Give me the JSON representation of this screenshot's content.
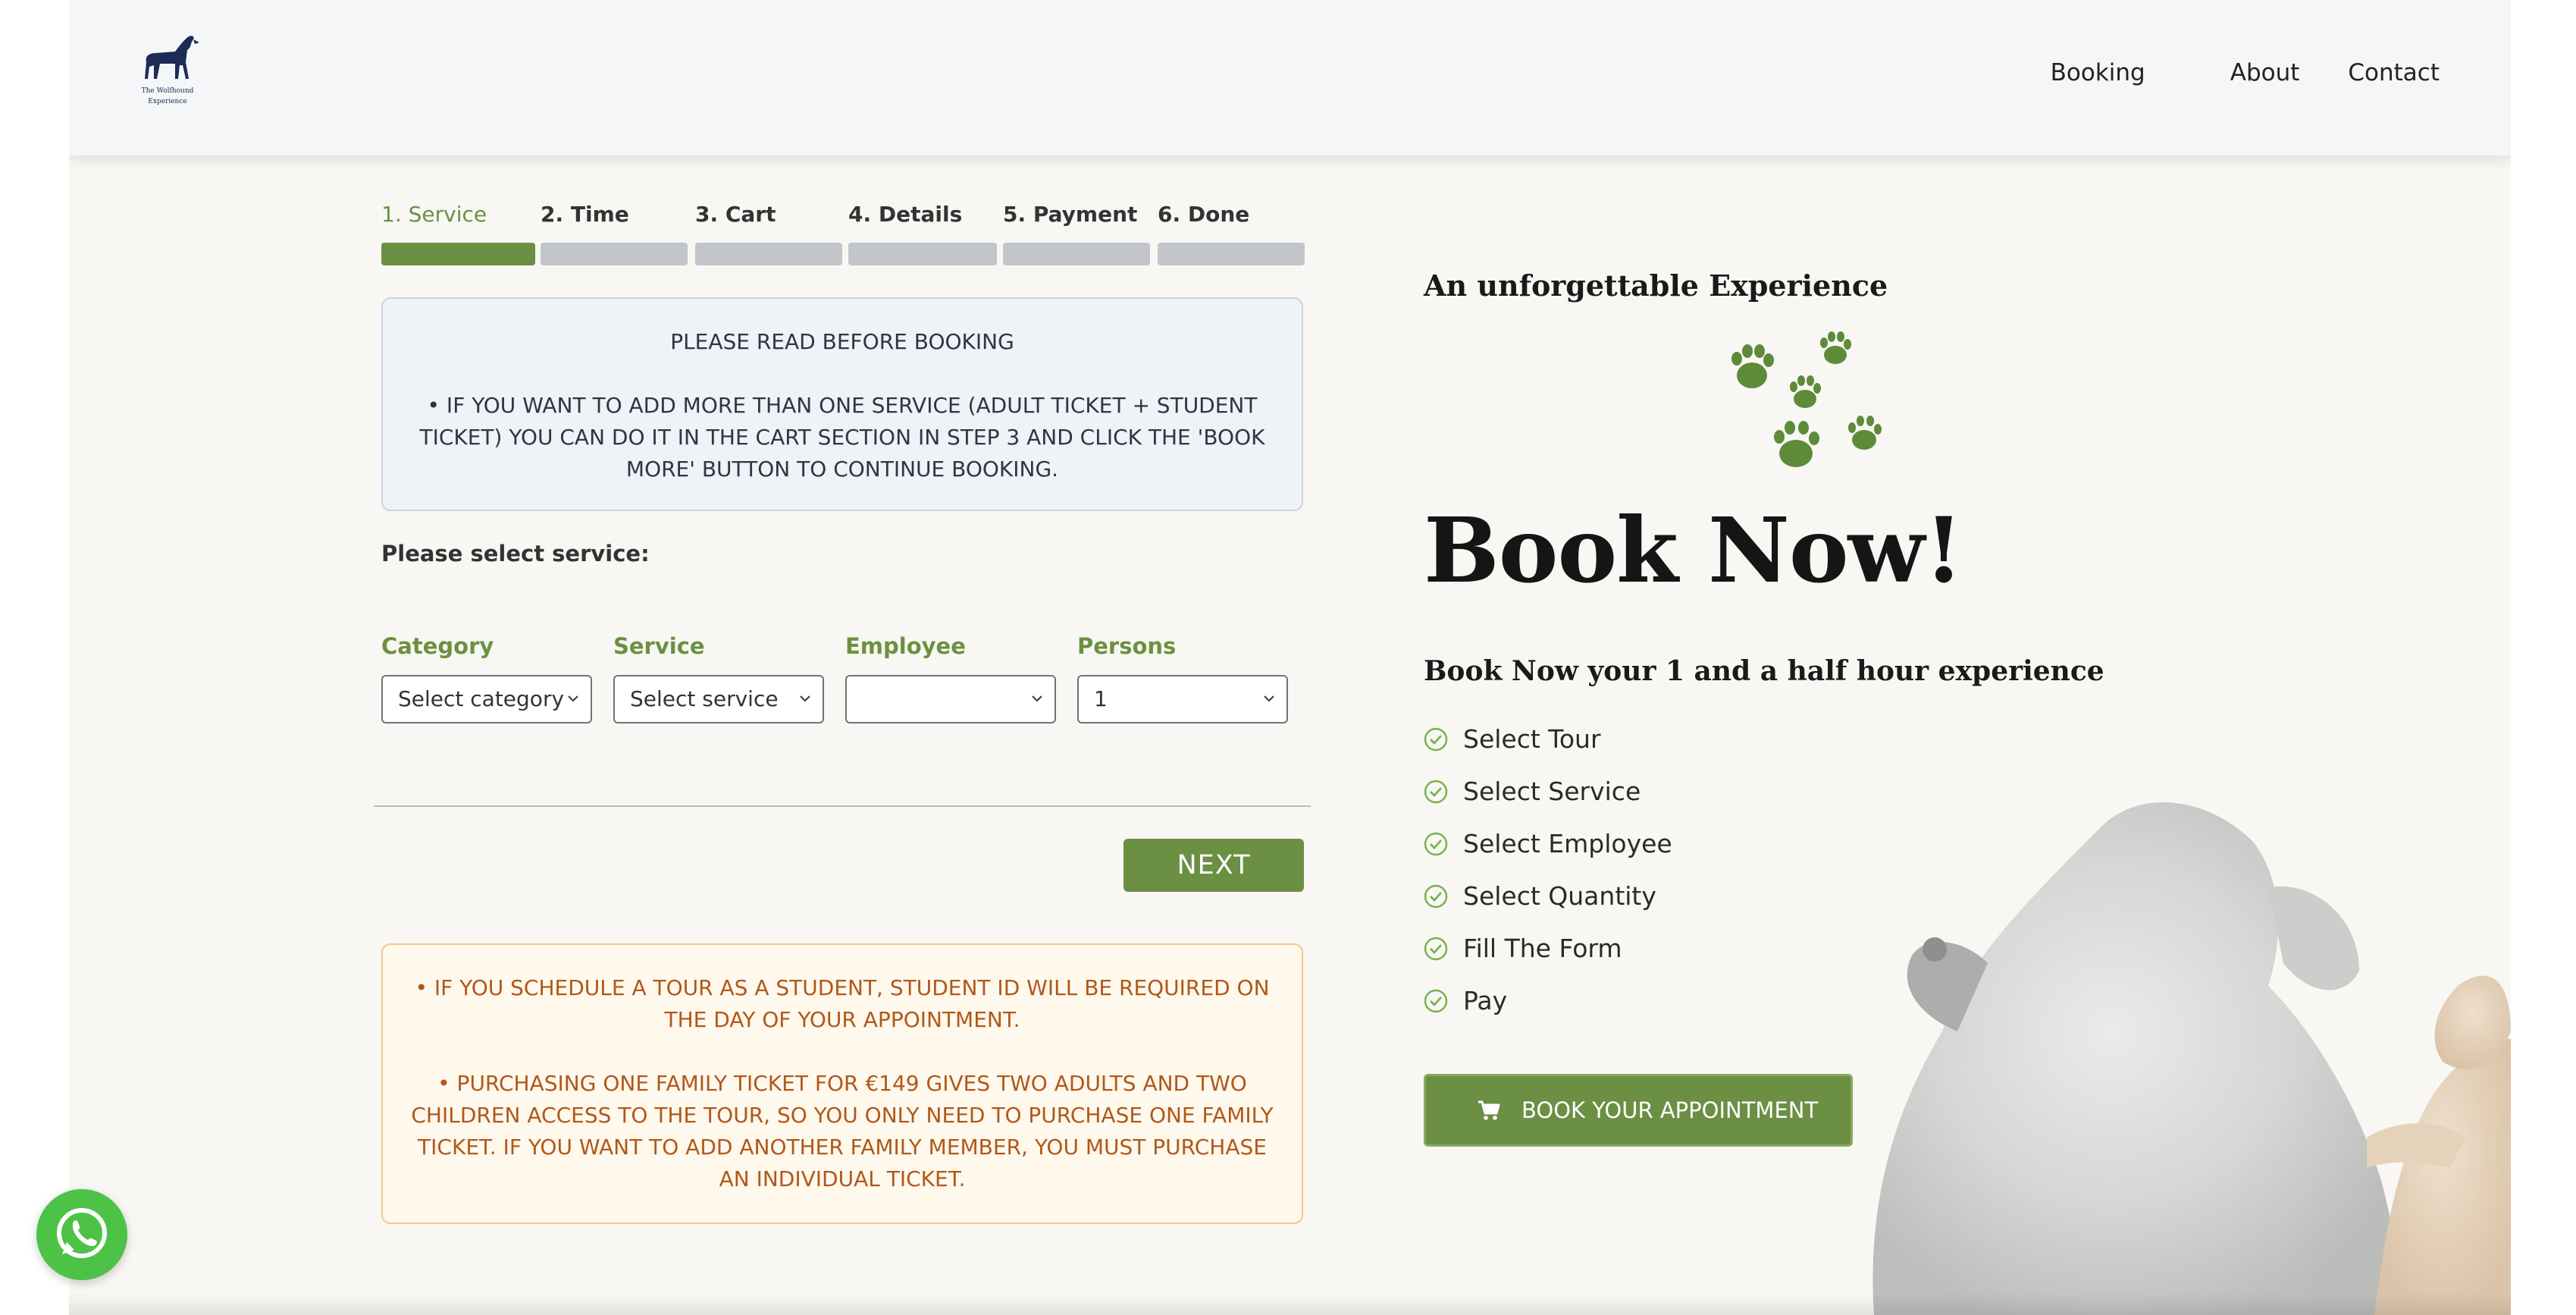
{
  "header": {
    "logo": {
      "line1": "The Wolfhound",
      "line2": "Experience"
    },
    "nav": [
      {
        "label": "Booking"
      },
      {
        "label": "About"
      },
      {
        "label": "Contact"
      }
    ]
  },
  "steps": [
    {
      "label": "1. Service",
      "active": true
    },
    {
      "label": "2. Time",
      "active": false
    },
    {
      "label": "3. Cart",
      "active": false
    },
    {
      "label": "4. Details",
      "active": false
    },
    {
      "label": "5. Payment",
      "active": false
    },
    {
      "label": "6. Done",
      "active": false
    }
  ],
  "notice_top": {
    "title": "PLEASE READ BEFORE BOOKING",
    "body": "• IF YOU WANT TO ADD MORE THAN ONE SERVICE (ADULT TICKET + STUDENT TICKET) YOU CAN DO IT IN THE CART SECTION IN STEP 3 AND CLICK THE 'BOOK MORE' BUTTON TO CONTINUE BOOKING."
  },
  "form": {
    "select_prompt": "Please select service:",
    "fields": [
      {
        "label": "Category",
        "value": "Select category"
      },
      {
        "label": "Service",
        "value": "Select service"
      },
      {
        "label": "Employee",
        "value": ""
      },
      {
        "label": "Persons",
        "value": "1"
      }
    ],
    "next_label": "NEXT"
  },
  "notice_bottom": {
    "p1": "• IF YOU SCHEDULE A TOUR AS A STUDENT, STUDENT ID WILL BE REQUIRED ON THE DAY OF YOUR APPOINTMENT.",
    "p2": "• PURCHASING ONE FAMILY TICKET FOR €149 GIVES TWO ADULTS AND TWO CHILDREN ACCESS TO THE TOUR, SO YOU ONLY NEED TO PURCHASE ONE FAMILY TICKET. IF YOU WANT TO ADD ANOTHER FAMILY MEMBER, YOU MUST PURCHASE AN INDIVIDUAL TICKET."
  },
  "promo": {
    "tagline": "An unforgettable Experience",
    "title": "Book Now!",
    "subtitle": "Book Now your 1 and a half hour experience",
    "checklist": [
      "Select Tour",
      "Select Service",
      "Select Employee",
      "Select Quantity",
      "Fill The Form",
      "Pay"
    ],
    "cta_label": "BOOK YOUR APPOINTMENT"
  },
  "icons": {
    "logo": "wolfhound-logo-icon",
    "paws": "paw-prints-icon",
    "check": "check-circle-icon",
    "cart": "cart-icon",
    "chevron": "chevron-down-icon",
    "whatsapp": "whatsapp-icon"
  },
  "colors": {
    "accent_green": "#6b8f43",
    "inactive_step": "#c2c5ca",
    "notice_orange_text": "#b0581a",
    "whatsapp_green": "#4dc247"
  }
}
